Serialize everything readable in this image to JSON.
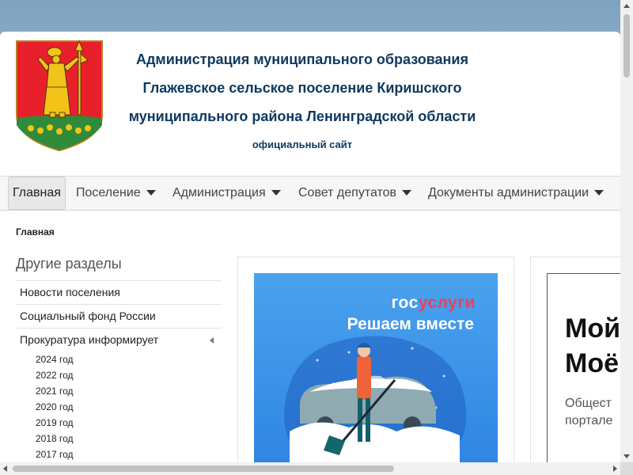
{
  "header": {
    "title_lines": [
      "Администрация муниципального образования",
      "Глажевское сельское поселение Киришского",
      "муниципального района Ленинградской области"
    ],
    "subtitle": "официальный сайт",
    "crest_icon": "coat-of-arms-icon"
  },
  "nav": {
    "items": [
      {
        "label": "Главная",
        "active": true
      },
      {
        "label": "Поселение",
        "dropdown": true
      },
      {
        "label": "Администрация",
        "dropdown": true
      },
      {
        "label": "Совет депутатов",
        "dropdown": true
      },
      {
        "label": "Документы администрации",
        "dropdown": true
      }
    ]
  },
  "breadcrumb": "Главная",
  "sidebar": {
    "title": "Другие разделы",
    "items": [
      {
        "label": "Новости поселения"
      },
      {
        "label": "Социальный фонд России"
      },
      {
        "label": "Прокуратура информирует",
        "expanded": true
      }
    ],
    "sub_items": [
      "2024 год",
      "2022 год",
      "2021 год",
      "2020 год",
      "2019 год",
      "2018 год",
      "2017 год"
    ]
  },
  "banners": {
    "gosuslugi": {
      "logo_part1": "гос",
      "logo_part2": "услуги",
      "slogan": "Решаем вместе"
    },
    "second": {
      "line1": "Мой",
      "line2": "Моё",
      "line3": "Общест",
      "line4": "портале"
    }
  },
  "colors": {
    "title": "#0f3a60",
    "gosuslugi_blue": "#2f86e3",
    "gosuslugi_red": "#ee3f58"
  }
}
